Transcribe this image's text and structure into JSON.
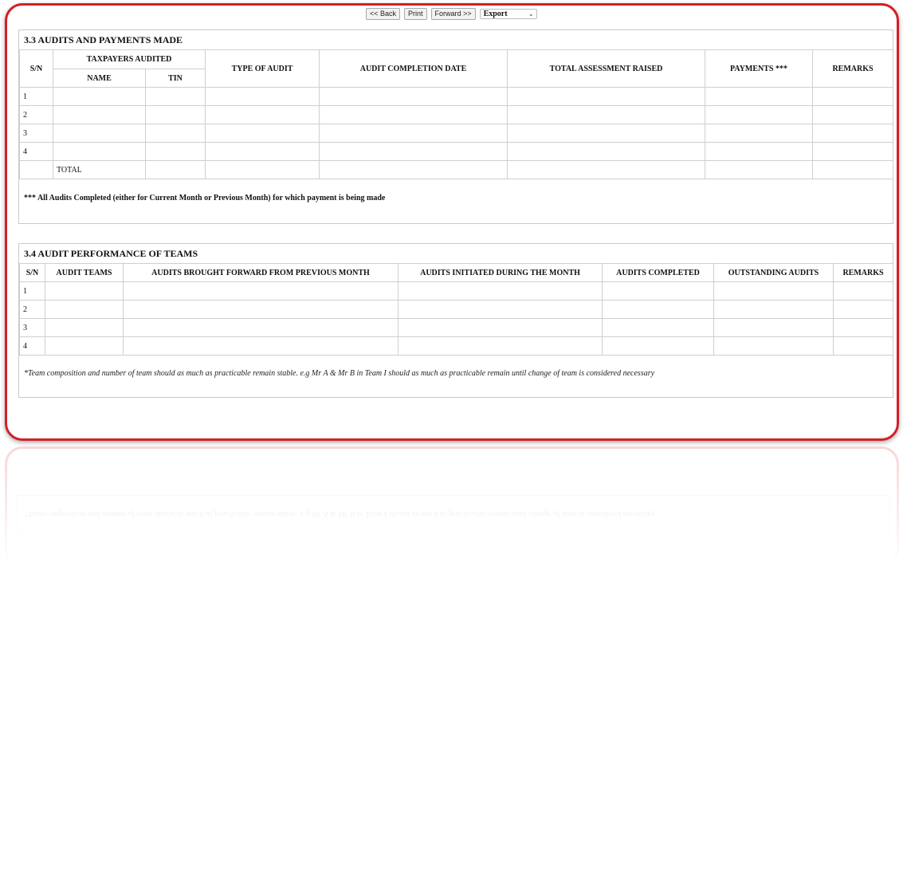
{
  "toolbar": {
    "back_label": "<< Back",
    "print_label": "Print",
    "forward_label": "Forward >>",
    "export_value": "Export"
  },
  "section_33": {
    "title": "3.3 AUDITS AND PAYMENTS MADE",
    "headers": {
      "sn": "S/N",
      "taxpayers_audited": "TAXPAYERS AUDITED",
      "name": "NAME",
      "tin": "TIN",
      "type_of_audit": "TYPE OF AUDIT",
      "audit_completion_date": "AUDIT COMPLETION DATE",
      "total_assessment_raised": "TOTAL ASSESSMENT RAISED",
      "payments": "PAYMENTS ***",
      "remarks": "REMARKS"
    },
    "rows": [
      "1",
      "2",
      "3",
      "4"
    ],
    "total_label": "TOTAL",
    "note": "*** All Audits Completed (either for Current Month or Previous Month) for which payment is being made"
  },
  "section_34": {
    "title": "3.4 AUDIT PERFORMANCE OF TEAMS",
    "headers": {
      "sn": "S/N",
      "audit_teams": "AUDIT TEAMS",
      "brought_forward": "AUDITS BROUGHT FORWARD FROM PREVIOUS MONTH",
      "initiated": "AUDITS INITIATED DURING THE MONTH",
      "completed": "AUDITS COMPLETED",
      "outstanding": "OUTSTANDING AUDITS",
      "remarks": "REMARKS"
    },
    "rows": [
      "1",
      "2",
      "3",
      "4"
    ],
    "note": "*Team composition and number of team should as much as practicable remain stable. e.g Mr A & Mr B in Team I should as much as practicable remain until change of team is considered necessary"
  },
  "colors": {
    "frame_border": "#d21f26",
    "grid_line": "#cfcfcf"
  }
}
